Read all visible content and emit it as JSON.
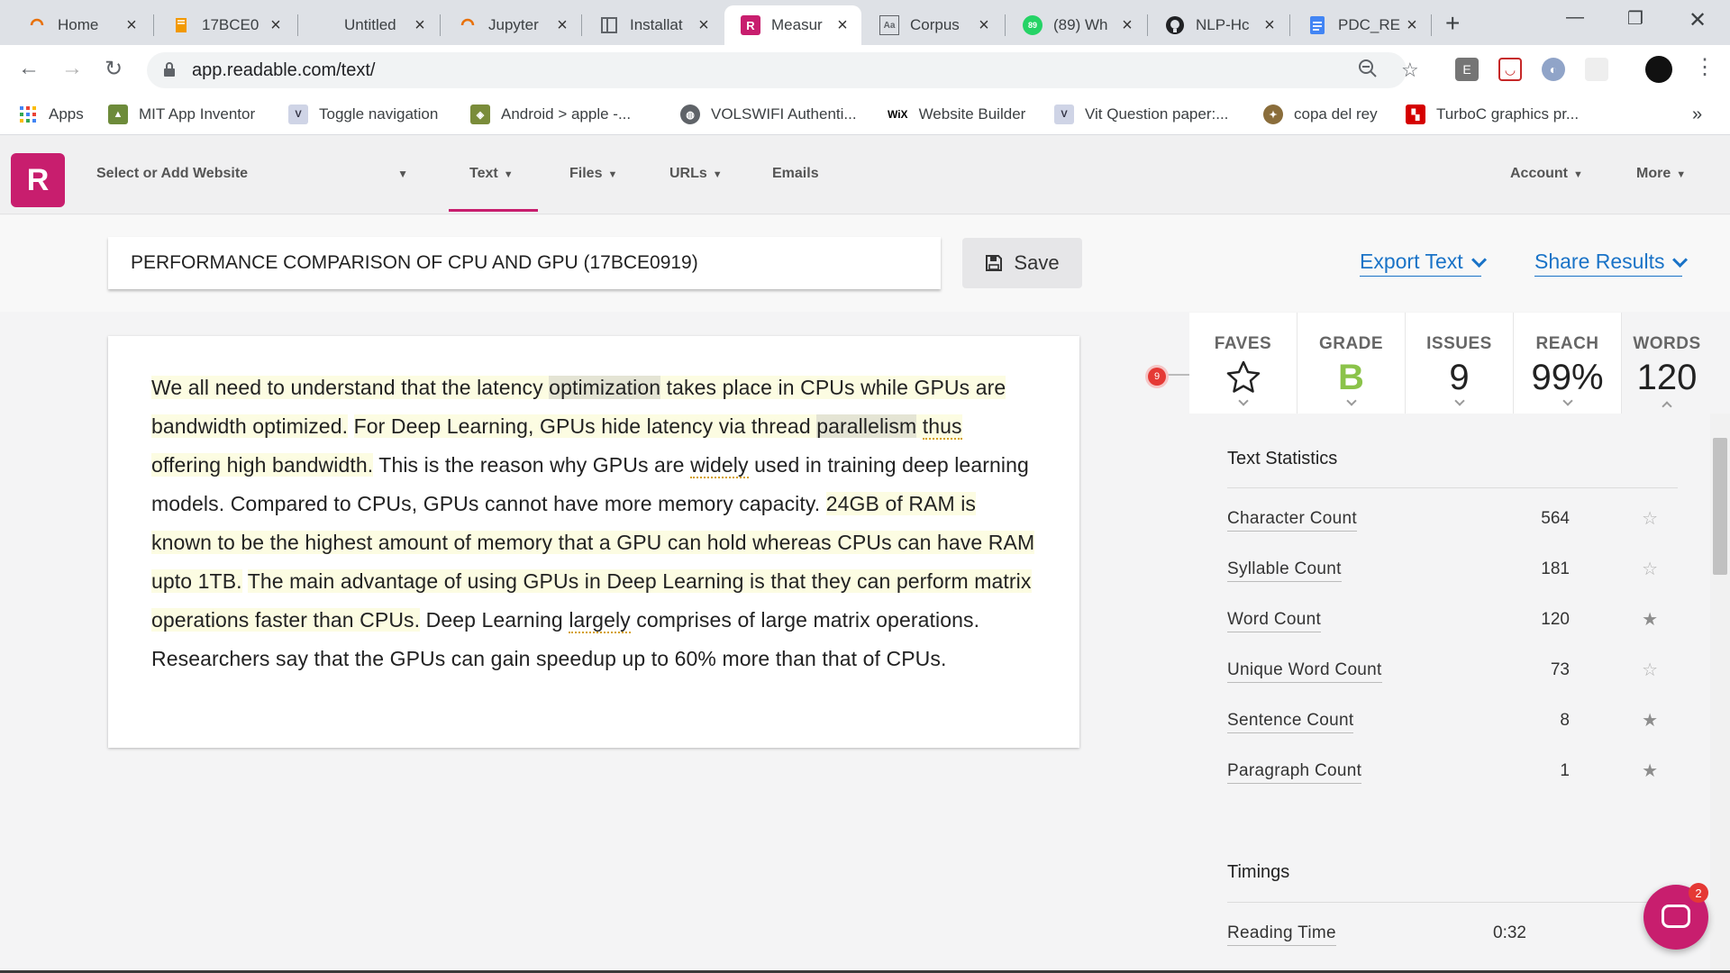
{
  "browser": {
    "tabs": [
      {
        "label": "Home",
        "icon": "loading-ring-icon",
        "color": "#e8710a"
      },
      {
        "label": "17BCE0",
        "icon": "book-icon",
        "color": "#f29900"
      },
      {
        "label": "Untitled",
        "icon": "",
        "color": ""
      },
      {
        "label": "Jupyter",
        "icon": "loading-ring-icon",
        "color": "#e8710a"
      },
      {
        "label": "Installat",
        "icon": "sidebar-page-icon",
        "color": "#5f6368"
      },
      {
        "label": "Measur",
        "icon": "readable-r-icon",
        "color": "#c81e6e"
      },
      {
        "label": "Corpus",
        "icon": "aa-page-icon",
        "color": "#5f6368"
      },
      {
        "label": "(89) Wh",
        "icon": "whatsapp-icon",
        "color": "#25d366"
      },
      {
        "label": "NLP-Hc",
        "icon": "github-icon",
        "color": "#202124"
      },
      {
        "label": "PDC_RE",
        "icon": "docs-icon",
        "color": "#4285f4"
      }
    ],
    "whatsapp_count": "89",
    "url": "app.readable.com/text/",
    "extension_e": "E",
    "bookmarks": [
      {
        "label": "Apps",
        "icon": "apps-grid-icon"
      },
      {
        "label": "MIT App Inventor",
        "icon": "app-inventor-icon"
      },
      {
        "label": "Toggle navigation",
        "icon": "vit-logo-icon"
      },
      {
        "label": "Android > apple -...",
        "icon": "android-icon"
      },
      {
        "label": "VOLSWIFI Authenti...",
        "icon": "globe-icon"
      },
      {
        "label": "Website Builder",
        "icon": "wix-icon"
      },
      {
        "label": "Vit Question paper:...",
        "icon": "vit-logo-icon"
      },
      {
        "label": "copa del rey",
        "icon": "football-icon"
      },
      {
        "label": "TurboC graphics pr...",
        "icon": "turboc-icon"
      }
    ],
    "bookmarks_overflow": "»",
    "wix_text": "WiX"
  },
  "app": {
    "logo": "R",
    "site_select": "Select or Add Website",
    "nav": {
      "text": "Text",
      "files": "Files",
      "urls": "URLs",
      "emails": "Emails",
      "account": "Account",
      "more": "More"
    },
    "accent": "#c81e6e"
  },
  "document": {
    "title": "PERFORMANCE COMPARISON OF CPU AND GPU (17BCE0919)",
    "save_label": "Save",
    "export_label": "Export Text",
    "share_label": "Share Results",
    "segments": [
      {
        "t": "We all need to understand that the latency ",
        "s": "hl"
      },
      {
        "t": "optimization",
        "s": "hl2"
      },
      {
        "t": " takes place in CPUs while GPUs are bandwidth optimized.",
        "s": "hl"
      },
      {
        "t": " ",
        "s": ""
      },
      {
        "t": "For Deep Learning, GPUs hide latency via thread ",
        "s": "hl"
      },
      {
        "t": "parallelism",
        "s": "hl2"
      },
      {
        "t": " ",
        "s": "hl"
      },
      {
        "t": "thus",
        "s": "hl dot"
      },
      {
        "t": " offering high bandwidth.",
        "s": "hl"
      },
      {
        "t": " This is the reason why GPUs are ",
        "s": ""
      },
      {
        "t": "widely",
        "s": "dot"
      },
      {
        "t": " used in training deep learning models. Compared to CPUs, GPUs cannot have more memory capacity. ",
        "s": ""
      },
      {
        "t": "24GB of RAM is known to be the highest amount of memory that a GPU can hold whereas CPUs can have RAM upto 1TB.",
        "s": "hl"
      },
      {
        "t": " ",
        "s": ""
      },
      {
        "t": "The main advantage of using GPUs in Deep Learning is that they can perform matrix operations faster than CPUs.",
        "s": "hl"
      },
      {
        "t": " Deep Learning ",
        "s": ""
      },
      {
        "t": "largely",
        "s": "dot"
      },
      {
        "t": " comprises of large matrix operations. Researchers say that the GPUs can gain speedup up to 60% more than that of CPUs.",
        "s": ""
      }
    ],
    "issues_badge": "9"
  },
  "stats": {
    "faves_label": "FAVES",
    "grade_label": "GRADE",
    "grade_value": "B",
    "grade_color": "#8bc34a",
    "issues_label": "ISSUES",
    "issues_value": "9",
    "reach_label": "REACH",
    "reach_value": "99%",
    "words_label": "WORDS",
    "words_value": "120",
    "text_stats_title": "Text Statistics",
    "rows": [
      {
        "name": "Character Count",
        "value": "564",
        "starred": false
      },
      {
        "name": "Syllable Count",
        "value": "181",
        "starred": false
      },
      {
        "name": "Word Count",
        "value": "120",
        "starred": true
      },
      {
        "name": "Unique Word Count",
        "value": "73",
        "starred": false
      },
      {
        "name": "Sentence Count",
        "value": "8",
        "starred": true
      },
      {
        "name": "Paragraph Count",
        "value": "1",
        "starred": true
      }
    ],
    "timings_title": "Timings",
    "timings": [
      {
        "name": "Reading Time",
        "value": "0:32"
      }
    ]
  },
  "chat": {
    "count": "2"
  }
}
